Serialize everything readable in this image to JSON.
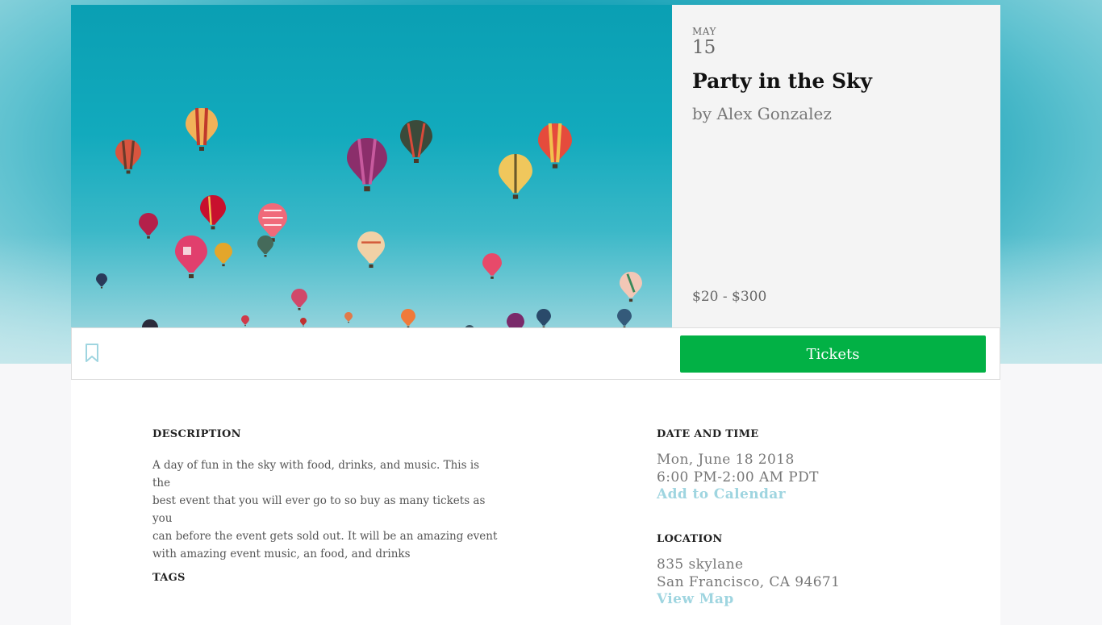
{
  "event": {
    "month": "MAY",
    "day": "15",
    "title": "Party in the Sky",
    "organizer": "by Alex Gonzalez",
    "price_range": "$20 - $300"
  },
  "actions": {
    "bookmark_icon": "bookmark-icon",
    "tickets_label": "Tickets",
    "tickets_color": "#02b145"
  },
  "description": {
    "heading": "DESCRIPTION",
    "lines": [
      "A day of fun in the sky with food, drinks, and music. This is the",
      "best event that you will ever go to so buy as many tickets as you",
      "can before the event gets sold out. It will be an amazing event",
      "with amazing event music, an food, and drinks"
    ]
  },
  "tags": {
    "heading": "TAGS"
  },
  "date_time": {
    "heading": "DATE AND TIME",
    "date": "Mon, June 18 2018",
    "time": "6:00 PM-2:00 AM PDT",
    "add_to_calendar": "Add to Calendar"
  },
  "location": {
    "heading": "LOCATION",
    "street": "835 skylane",
    "city": "San Francisco, CA 94671",
    "view_map": "View Map"
  },
  "colors": {
    "link": "#9fd5e0",
    "sky": "#12aabd"
  }
}
